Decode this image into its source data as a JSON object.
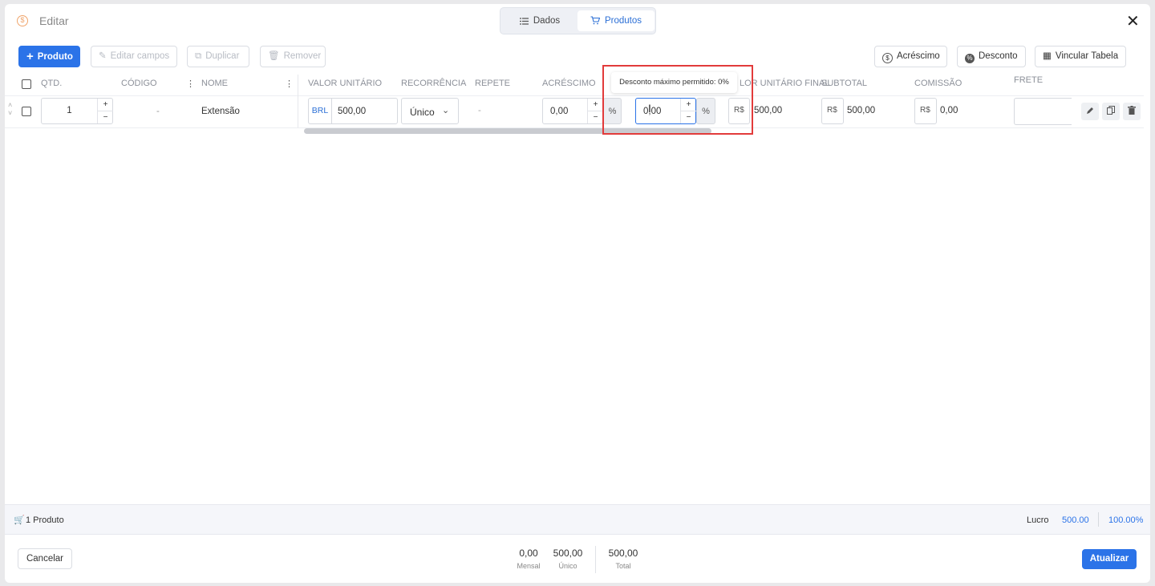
{
  "header": {
    "title": "Editar",
    "icon": "dollar-circle-icon",
    "close": "✕"
  },
  "tabs": [
    {
      "label": "Dados"
    },
    {
      "label": "Produtos"
    }
  ],
  "toolbar": {
    "produto": "Produto",
    "editar_campos": "Editar campos",
    "duplicar": "Duplicar",
    "remover": "Remover",
    "acrescimo": "Acréscimo",
    "desconto": "Desconto",
    "vincular_tabela": "Vincular Tabela"
  },
  "columns": {
    "qtd": "QTD.",
    "codigo": "CÓDIGO",
    "nome": "NOME",
    "valor_unitario": "VALOR UNITÁRIO",
    "recorrencia": "RECORRÊNCIA",
    "repete": "REPETE",
    "acrescimo": "ACRÉSCIMO",
    "valor_unitario_final": "LOR UNITÁRIO FINAL",
    "subtotal": "SUBTOTAL",
    "comissao": "COMISSÃO",
    "frete": "FRETE"
  },
  "row": {
    "qtd": "1",
    "codigo": "-",
    "nome": "Extensão",
    "currency": "BRL",
    "valor_unitario": "500,00",
    "recorrencia": "Único",
    "repete": "-",
    "acrescimo": "0,00",
    "acrescimo_unit": "%",
    "desconto": "0,00",
    "desconto_unit": "%",
    "final_currency": "R$",
    "valor_unitario_final": "500,00",
    "subtotal_currency": "R$",
    "subtotal": "500,00",
    "comissao_currency": "R$",
    "comissao": "0,00",
    "frete": ""
  },
  "tooltip": "Desconto máximo permitido: 0%",
  "info_bar": {
    "produtos": "1 Produto",
    "lucro_label": "Lucro",
    "lucro_value": "500.00",
    "lucro_percent": "100.00%"
  },
  "footer": {
    "cancelar": "Cancelar",
    "mensal_value": "0,00",
    "mensal_label": "Mensal",
    "unico_value": "500,00",
    "unico_label": "Único",
    "total_value": "500,00",
    "total_label": "Total",
    "atualizar": "Atualizar"
  },
  "colors": {
    "primary": "#2b73e8",
    "highlight": "#e23b3b",
    "accent": "#f0a56b"
  }
}
